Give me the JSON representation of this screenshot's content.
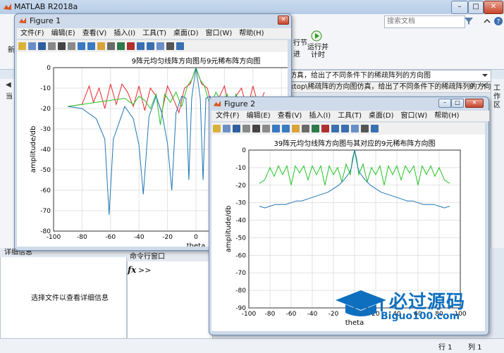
{
  "main": {
    "title": "MATLAB R2018a",
    "search_placeholder": "搜索文档",
    "toolstrip": {
      "run_section_label": "行节",
      "advance_label": "进",
      "run_advance_label": "运行并\n计时",
      "new_label": "新"
    },
    "path_text": "仿真，给出了不同条件下的稀疏阵列的方向图",
    "editor_tab": "ktop\\稀疏阵的方向图仿真，给出了不同条件下的稀疏阵列的方向...",
    "left_tab_label": "当",
    "workspace_label": "工作区",
    "details_header": "详细信息",
    "details_text": "选择文件以查看详细信息",
    "cmd_header": "命令行窗口",
    "cmd_prompt": ">>",
    "status_row": "行  1",
    "status_col": "列  1"
  },
  "menu_items": [
    "文件(F)",
    "编辑(E)",
    "查看(V)",
    "插入(I)",
    "工具(T)",
    "桌面(D)",
    "窗口(W)",
    "帮助(H)"
  ],
  "figure1": {
    "title": "Figure 1"
  },
  "figure2": {
    "title": "Figure 2"
  },
  "colors": {
    "red": "#e8262a",
    "green": "#22c322",
    "blue": "#1f77b4"
  },
  "watermark": {
    "text": "必过源码",
    "sub": "Biguo100.com"
  },
  "chart_data": [
    {
      "type": "line",
      "title": "9阵元均匀线阵方向图与9元稀布阵方向图",
      "xlabel": "theta",
      "ylabel": "amplitude/db",
      "xlim": [
        -100,
        100
      ],
      "ylim": [
        -80,
        0
      ],
      "xticks": [
        -100,
        -80,
        -60,
        -40,
        -20,
        0,
        20,
        40,
        60,
        80,
        100
      ],
      "yticks": [
        0,
        -10,
        -20,
        -30,
        -40,
        -50,
        -60,
        -70,
        -80
      ],
      "visible_xlim": [
        -100,
        48
      ],
      "grid": true,
      "series": [
        {
          "color": "#e8262a",
          "kind": "sparse-9",
          "x": [
            -90,
            -80,
            -75,
            -72,
            -68,
            -64,
            -60,
            -56,
            -52,
            -48,
            -44,
            -40,
            -36,
            -32,
            -28,
            -24,
            -20,
            -16,
            -12,
            -8,
            -4,
            0,
            4,
            8,
            12,
            16,
            20,
            24,
            28,
            32,
            36,
            40,
            44,
            48
          ],
          "y": [
            -19,
            -18,
            -9,
            -17,
            -10,
            -20,
            -8,
            -18,
            -8,
            -12,
            -19,
            -9,
            -21,
            -10,
            -14,
            -22,
            -9,
            -15,
            -22,
            -10,
            -8,
            0,
            -8,
            -10,
            -22,
            -15,
            -9,
            -22,
            -14,
            -10,
            -21,
            -9,
            -19,
            -12
          ]
        },
        {
          "color": "#22c322",
          "kind": "uniform-9-mirror",
          "x": [
            -90,
            -80,
            -70,
            -60,
            -50,
            -44,
            -40,
            -36,
            -32,
            -28,
            -25,
            -22,
            -18,
            -14,
            -10,
            -6,
            -3,
            0,
            3,
            6,
            10,
            14,
            18,
            22,
            25,
            28,
            32,
            36,
            40,
            44,
            48
          ],
          "y": [
            -19,
            -18,
            -17,
            -16,
            -15,
            -18,
            -14,
            -16,
            -20,
            -13,
            -28,
            -13,
            -17,
            -12,
            -19,
            -9,
            -6,
            0,
            -6,
            -9,
            -19,
            -12,
            -17,
            -13,
            -28,
            -13,
            -20,
            -16,
            -14,
            -18,
            -15
          ]
        },
        {
          "color": "#1f77b4",
          "kind": "uniform-9",
          "x": [
            -90,
            -80,
            -70,
            -64,
            -61,
            -58,
            -50,
            -44,
            -40,
            -37,
            -33,
            -28,
            -24,
            -20,
            -17,
            -14,
            -10,
            -7,
            -5,
            -3,
            0,
            3,
            5,
            7,
            10,
            14,
            17,
            20,
            24,
            28,
            33,
            37,
            40,
            44,
            48
          ],
          "y": [
            -19,
            -20,
            -25,
            -35,
            -72,
            -35,
            -19,
            -25,
            -38,
            -62,
            -24,
            -14,
            -22,
            -37,
            -60,
            -22,
            -14,
            -15,
            -55,
            -15,
            0,
            -15,
            -55,
            -15,
            -14,
            -22,
            -60,
            -37,
            -22,
            -14,
            -24,
            -62,
            -38,
            -25,
            -19
          ]
        }
      ]
    },
    {
      "type": "line",
      "title": "39阵元均匀线阵方向图与其对应的9元稀布阵方向图",
      "xlabel": "theta",
      "ylabel": "amplitude/db",
      "xlim": [
        -100,
        100
      ],
      "ylim": [
        -90,
        0
      ],
      "xticks": [
        -100,
        -80,
        -60,
        -40,
        -20,
        0,
        20,
        40,
        60,
        80,
        100
      ],
      "yticks": [
        0,
        -10,
        -20,
        -30,
        -40,
        -50,
        -60,
        -70,
        -80,
        -90
      ],
      "grid": true,
      "series": [
        {
          "color": "#22c322",
          "kind": "sparse-9",
          "x": [
            -90,
            -85,
            -80,
            -76,
            -72,
            -68,
            -64,
            -60,
            -56,
            -52,
            -48,
            -44,
            -40,
            -36,
            -32,
            -28,
            -24,
            -20,
            -16,
            -12,
            -8,
            -4,
            -2,
            0,
            2,
            4,
            8,
            12,
            16,
            20,
            24,
            28,
            32,
            36,
            40,
            44,
            48,
            52,
            56,
            60,
            64,
            68,
            72,
            76,
            80,
            85,
            90
          ],
          "y": [
            -19,
            -17,
            -10,
            -15,
            -9,
            -14,
            -9,
            -20,
            -9,
            -13,
            -9,
            -17,
            -9,
            -14,
            -9,
            -20,
            -9,
            -14,
            -10,
            -18,
            -8,
            -14,
            -5,
            0,
            -5,
            -14,
            -8,
            -18,
            -10,
            -14,
            -9,
            -20,
            -9,
            -14,
            -9,
            -17,
            -9,
            -13,
            -9,
            -20,
            -9,
            -14,
            -9,
            -15,
            -10,
            -17,
            -19
          ]
        },
        {
          "color": "#1f77b4",
          "kind": "uniform-39",
          "x": [
            -90,
            -85,
            -80,
            -75,
            -70,
            -65,
            -60,
            -55,
            -50,
            -45,
            -40,
            -35,
            -30,
            -25,
            -20,
            -15,
            -10,
            -5,
            -3,
            0,
            3,
            5,
            10,
            15,
            20,
            25,
            30,
            35,
            40,
            45,
            50,
            55,
            60,
            65,
            70,
            75,
            80,
            85,
            90
          ],
          "y": [
            -32,
            -33,
            -32,
            -31,
            -31,
            -31,
            -30,
            -29,
            -29,
            -28,
            -27,
            -26,
            -25,
            -24,
            -22,
            -20,
            -17,
            -13,
            -10,
            0,
            -10,
            -13,
            -17,
            -20,
            -22,
            -24,
            -25,
            -26,
            -27,
            -28,
            -29,
            -29,
            -30,
            -31,
            -31,
            -31,
            -32,
            -33,
            -32
          ]
        }
      ]
    }
  ]
}
